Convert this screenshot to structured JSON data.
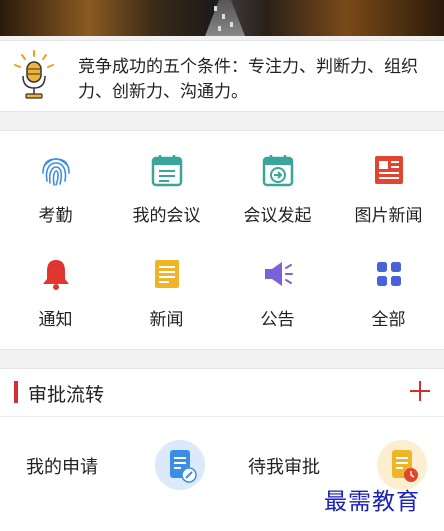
{
  "notice": {
    "text": "竞争成功的五个条件：专注力、判断力、组织力、创新力、沟通力。"
  },
  "grid": [
    {
      "label": "考勤",
      "icon": "fingerprint-icon",
      "color": "#3a8ee6"
    },
    {
      "label": "我的会议",
      "icon": "calendar-icon",
      "color": "#3aa59a"
    },
    {
      "label": "会议发起",
      "icon": "calendar-arrow-icon",
      "color": "#3aa59a"
    },
    {
      "label": "图片新闻",
      "icon": "newspaper-icon",
      "color": "#e0462f"
    },
    {
      "label": "通知",
      "icon": "bell-icon",
      "color": "#e0362f"
    },
    {
      "label": "新闻",
      "icon": "news-doc-icon",
      "color": "#f0b429"
    },
    {
      "label": "公告",
      "icon": "megaphone-icon",
      "color": "#7b61d9"
    },
    {
      "label": "全部",
      "icon": "apps-grid-icon",
      "color": "#4a62d8"
    }
  ],
  "approval": {
    "title": "审批流转",
    "add_icon": "plus-icon",
    "items": [
      {
        "label": "我的申请",
        "icon": "application-doc-icon",
        "color": "#3a8ee6"
      },
      {
        "label": "待我审批",
        "icon": "pending-doc-icon",
        "color": "#f0b429"
      }
    ]
  },
  "watermark": "最需教育",
  "colors": {
    "accent": "#d32f2f",
    "watermark": "#1a22b8"
  }
}
